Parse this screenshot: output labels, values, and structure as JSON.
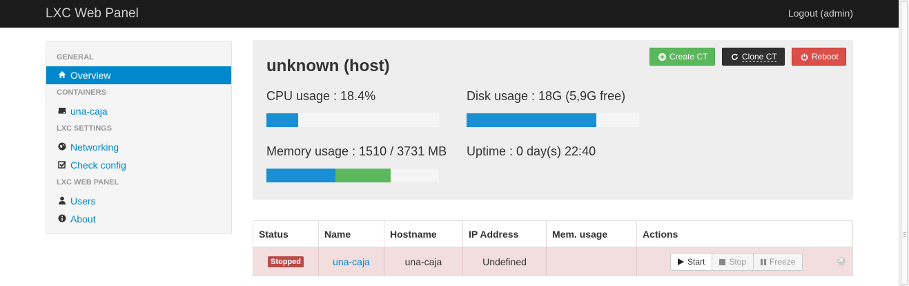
{
  "navbar": {
    "brand": "LXC Web Panel",
    "logout": "Logout (admin)"
  },
  "sidebar": {
    "sections": {
      "general": "GENERAL",
      "containers": "CONTAINERS",
      "lxc_settings": "LXC SETTINGS",
      "lxc_web_panel": "LXC WEB PANEL"
    },
    "items": {
      "overview": "Overview",
      "una_caja": "una-caja",
      "networking": "Networking",
      "check_config": "Check config",
      "users": "Users",
      "about": "About"
    }
  },
  "hero": {
    "title": "unknown (host)",
    "buttons": {
      "create": "Create CT",
      "clone": "Clone CT",
      "reboot": "Reboot"
    },
    "cpu": {
      "label": "CPU usage : 18.4%",
      "percent": 18.4
    },
    "disk": {
      "label": "Disk usage : 18G (5,9G free)",
      "percent": 75
    },
    "memory": {
      "label": "Memory usage : 1510 / 3731 MB",
      "used_percent": 40,
      "cached_percent": 32
    },
    "uptime": "Uptime : 0 day(s) 22:40"
  },
  "table": {
    "headers": [
      "Status",
      "Name",
      "Hostname",
      "IP Address",
      "Mem. usage",
      "Actions"
    ],
    "rows": [
      {
        "status": "Stopped",
        "name": "una-caja",
        "hostname": "una-caja",
        "ip": "Undefined",
        "mem": "",
        "actions": {
          "start": "Start",
          "stop": "Stop",
          "freeze": "Freeze"
        }
      }
    ]
  },
  "colors": {
    "accent": "#0088cc",
    "success": "#5bb75b",
    "danger": "#da4f49",
    "stopped_row": "#f2dede"
  }
}
